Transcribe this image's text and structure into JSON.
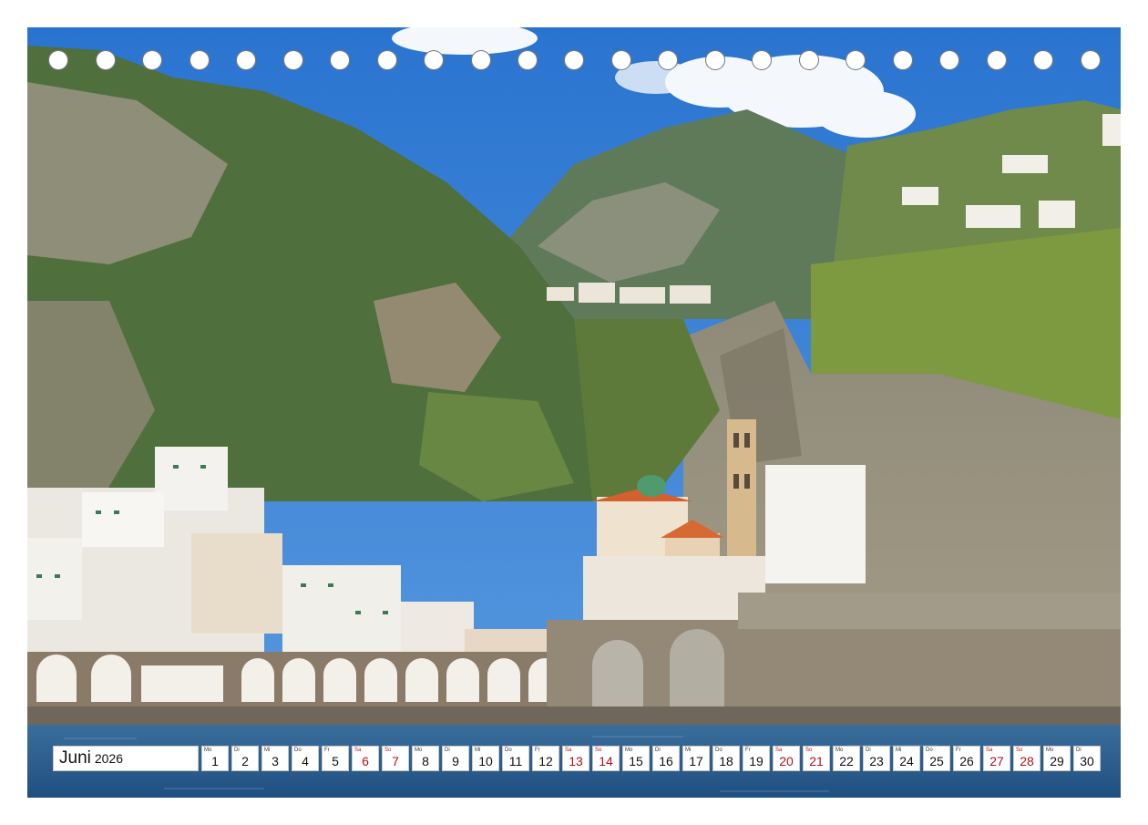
{
  "colors": {
    "sky": "#2f7fd6",
    "sea": "#2d5f8f",
    "weekend_text": "#b0121b",
    "hole": "#ffffff"
  },
  "photo": {
    "subject": "Atrani town on the Amalfi Coast with church dome, bell tower and arched seawall"
  },
  "binding_holes": 23,
  "calendar": {
    "month": "Juni",
    "year": "2026",
    "days": [
      {
        "wd": "Mo",
        "d": "1",
        "weekend": false
      },
      {
        "wd": "Di",
        "d": "2",
        "weekend": false
      },
      {
        "wd": "Mi",
        "d": "3",
        "weekend": false
      },
      {
        "wd": "Do",
        "d": "4",
        "weekend": false
      },
      {
        "wd": "Fr",
        "d": "5",
        "weekend": false
      },
      {
        "wd": "Sa",
        "d": "6",
        "weekend": true
      },
      {
        "wd": "So",
        "d": "7",
        "weekend": true
      },
      {
        "wd": "Mo",
        "d": "8",
        "weekend": false
      },
      {
        "wd": "Di",
        "d": "9",
        "weekend": false
      },
      {
        "wd": "Mi",
        "d": "10",
        "weekend": false
      },
      {
        "wd": "Do",
        "d": "11",
        "weekend": false
      },
      {
        "wd": "Fr",
        "d": "12",
        "weekend": false
      },
      {
        "wd": "Sa",
        "d": "13",
        "weekend": true
      },
      {
        "wd": "So",
        "d": "14",
        "weekend": true
      },
      {
        "wd": "Mo",
        "d": "15",
        "weekend": false
      },
      {
        "wd": "Di",
        "d": "16",
        "weekend": false
      },
      {
        "wd": "Mi",
        "d": "17",
        "weekend": false
      },
      {
        "wd": "Do",
        "d": "18",
        "weekend": false
      },
      {
        "wd": "Fr",
        "d": "19",
        "weekend": false
      },
      {
        "wd": "Sa",
        "d": "20",
        "weekend": true
      },
      {
        "wd": "So",
        "d": "21",
        "weekend": true
      },
      {
        "wd": "Mo",
        "d": "22",
        "weekend": false
      },
      {
        "wd": "Di",
        "d": "23",
        "weekend": false
      },
      {
        "wd": "Mi",
        "d": "24",
        "weekend": false
      },
      {
        "wd": "Do",
        "d": "25",
        "weekend": false
      },
      {
        "wd": "Fr",
        "d": "26",
        "weekend": false
      },
      {
        "wd": "Sa",
        "d": "27",
        "weekend": true
      },
      {
        "wd": "So",
        "d": "28",
        "weekend": true
      },
      {
        "wd": "Mo",
        "d": "29",
        "weekend": false
      },
      {
        "wd": "Di",
        "d": "30",
        "weekend": false
      }
    ]
  }
}
